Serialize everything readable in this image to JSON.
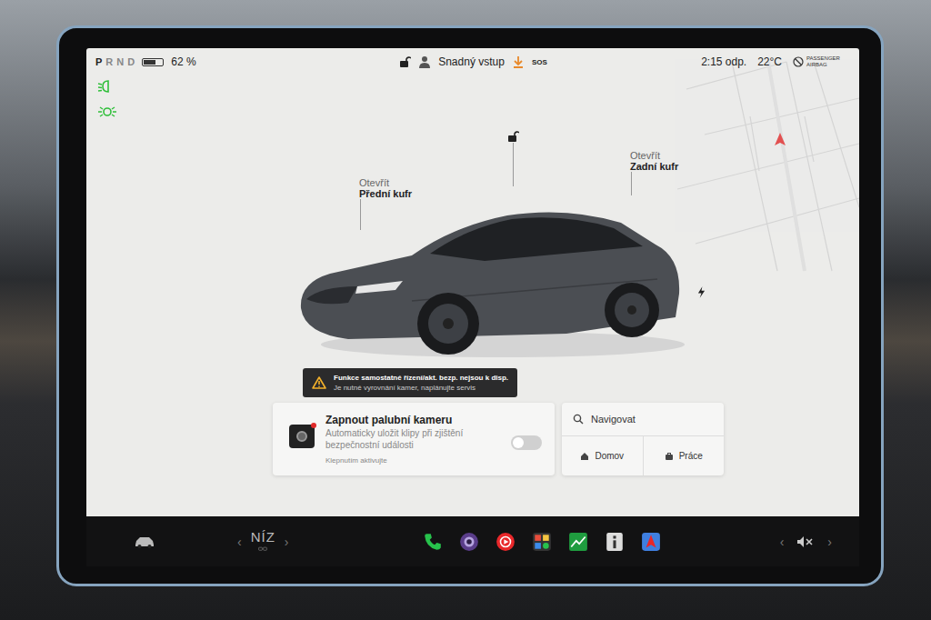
{
  "status_bar": {
    "gears": [
      {
        "label": "P",
        "selected": true
      },
      {
        "label": "R",
        "selected": false
      },
      {
        "label": "N",
        "selected": false
      },
      {
        "label": "D",
        "selected": false
      }
    ],
    "battery": {
      "level": 0.62,
      "reading": "62 %"
    },
    "locked": false,
    "profile": "Snadný vstup",
    "sos": "SOS",
    "time": "2:15 odp.",
    "temperature": "22°C",
    "airbag": "PASSENGER AIRBAG"
  },
  "lights": [
    {
      "kind": "low-beam",
      "on": true
    },
    {
      "kind": "parking",
      "on": true
    }
  ],
  "car": {
    "locked": false,
    "charging": true,
    "front_trunk": {
      "action": "Otevřít",
      "label": "Přední kufr"
    },
    "rear_trunk": {
      "action": "Otevřít",
      "label": "Zadní kufr"
    }
  },
  "alert": {
    "title": "Funkce samostatné řízení/akt. bezp. nejsou k disp.",
    "message": "Je nutné vyrovnání kamer, naplánujte servis"
  },
  "dashcam_card": {
    "title": "Zapnout palubní kameru",
    "description": "Automaticky uložit klipy při zjištění bezpečnostní události",
    "hint": "Klepnutím aktivujte",
    "on": false
  },
  "navigation_card": {
    "placeholder": "Navigovat",
    "shortcuts": [
      {
        "label": "Domov",
        "kind": "home"
      },
      {
        "label": "Práce",
        "kind": "work"
      }
    ]
  },
  "dock": {
    "climate": {
      "prev": "‹",
      "label": "NÍZ",
      "next": "›"
    },
    "apps": [
      {
        "kind": "phone"
      },
      {
        "kind": "camera"
      },
      {
        "kind": "music"
      },
      {
        "kind": "apps"
      },
      {
        "kind": "chart"
      },
      {
        "kind": "info"
      },
      {
        "kind": "nav"
      }
    ],
    "volume": {
      "prev": "‹",
      "next": "›",
      "muted": true
    }
  }
}
